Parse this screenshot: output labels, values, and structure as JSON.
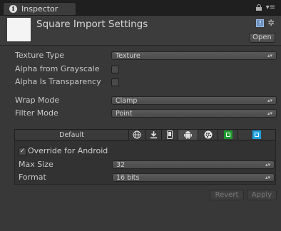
{
  "tab": {
    "title": "Inspector"
  },
  "header": {
    "asset_title": "Square Import Settings",
    "open_label": "Open"
  },
  "properties": {
    "texture_type": {
      "label": "Texture Type",
      "value": "Texture"
    },
    "alpha_from_grayscale": {
      "label": "Alpha from Grayscale",
      "checked": false
    },
    "alpha_is_transparency": {
      "label": "Alpha Is Transparency",
      "checked": false
    },
    "wrap_mode": {
      "label": "Wrap Mode",
      "value": "Clamp"
    },
    "filter_mode": {
      "label": "Filter Mode",
      "value": "Point"
    }
  },
  "platforms": {
    "tabs": [
      {
        "label": "Default",
        "icon": "default-tab"
      },
      {
        "label": "",
        "icon": "web-globe-icon"
      },
      {
        "label": "",
        "icon": "standalone-download-icon"
      },
      {
        "label": "",
        "icon": "iphone-icon"
      },
      {
        "label": "",
        "icon": "android-icon",
        "active": true
      },
      {
        "label": "",
        "icon": "blackberry-icon"
      },
      {
        "label": "",
        "icon": "windows-store-icon"
      },
      {
        "label": "",
        "icon": "windows-phone-icon"
      }
    ],
    "override": {
      "label": "Override for Android",
      "checked": true
    },
    "max_size": {
      "label": "Max Size",
      "value": "32"
    },
    "format": {
      "label": "Format",
      "value": "16 bits"
    }
  },
  "footer": {
    "revert_label": "Revert",
    "apply_label": "Apply"
  },
  "colors": {
    "windows_store_green": "#1e9a2e",
    "windows_phone_blue": "#1ea0e0"
  }
}
